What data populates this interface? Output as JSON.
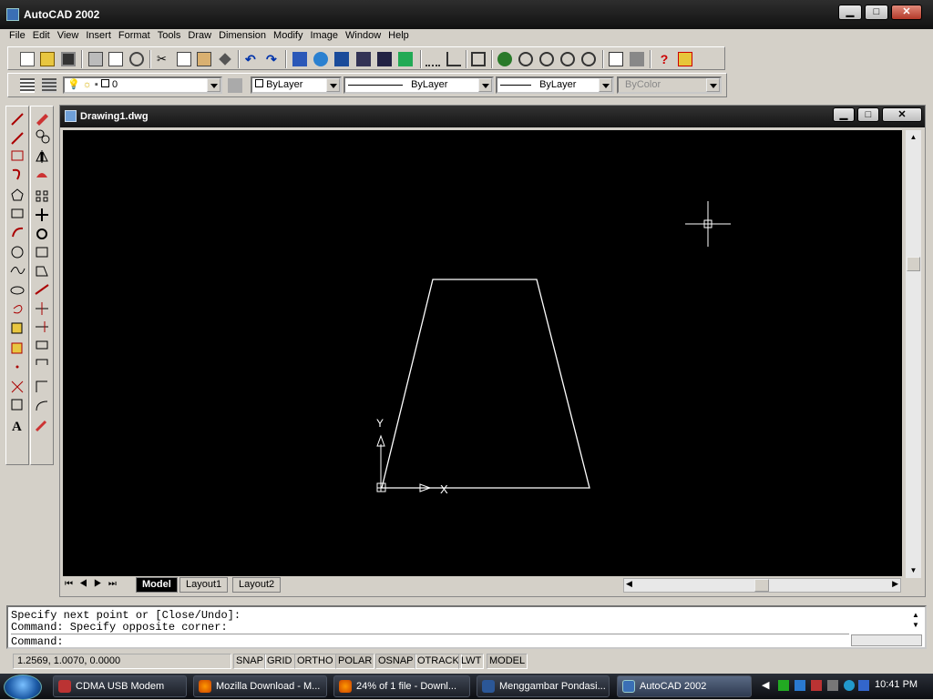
{
  "app": {
    "title": "AutoCAD 2002",
    "min": "▁",
    "max": "□",
    "close": "✕"
  },
  "menu": [
    "File",
    "Edit",
    "View",
    "Insert",
    "Format",
    "Tools",
    "Draw",
    "Dimension",
    "Modify",
    "Image",
    "Window",
    "Help"
  ],
  "properties": {
    "layer": "0",
    "color": "ByLayer",
    "linetype": "ByLayer",
    "lineweight": "ByLayer",
    "plotstyle": "ByColor"
  },
  "document": {
    "title": "Drawing1.dwg"
  },
  "drawing": {
    "shape": "trapezoid",
    "ucs_x_label": "X",
    "ucs_y_label": "Y"
  },
  "tabs": [
    "Model",
    "Layout1",
    "Layout2"
  ],
  "command_lines": [
    "Specify next point or [Close/Undo]:",
    "Command: Specify opposite corner:",
    "Command:"
  ],
  "status": {
    "coords": "1.2569, 1.0070, 0.0000",
    "buttons": [
      "SNAP",
      "GRID",
      "ORTHO",
      "POLAR",
      "OSNAP",
      "OTRACK",
      "LWT",
      "MODEL"
    ]
  },
  "taskbar": {
    "items": [
      "CDMA USB Modem",
      "Mozilla Download - M...",
      "24% of 1 file - Downl...",
      "Menggambar Pondasi...",
      "AutoCAD 2002"
    ],
    "clock": "10:41 PM"
  },
  "colors": {
    "canvas": "#000000",
    "lines": "#ffffff",
    "chrome": "#d4d0c8"
  }
}
